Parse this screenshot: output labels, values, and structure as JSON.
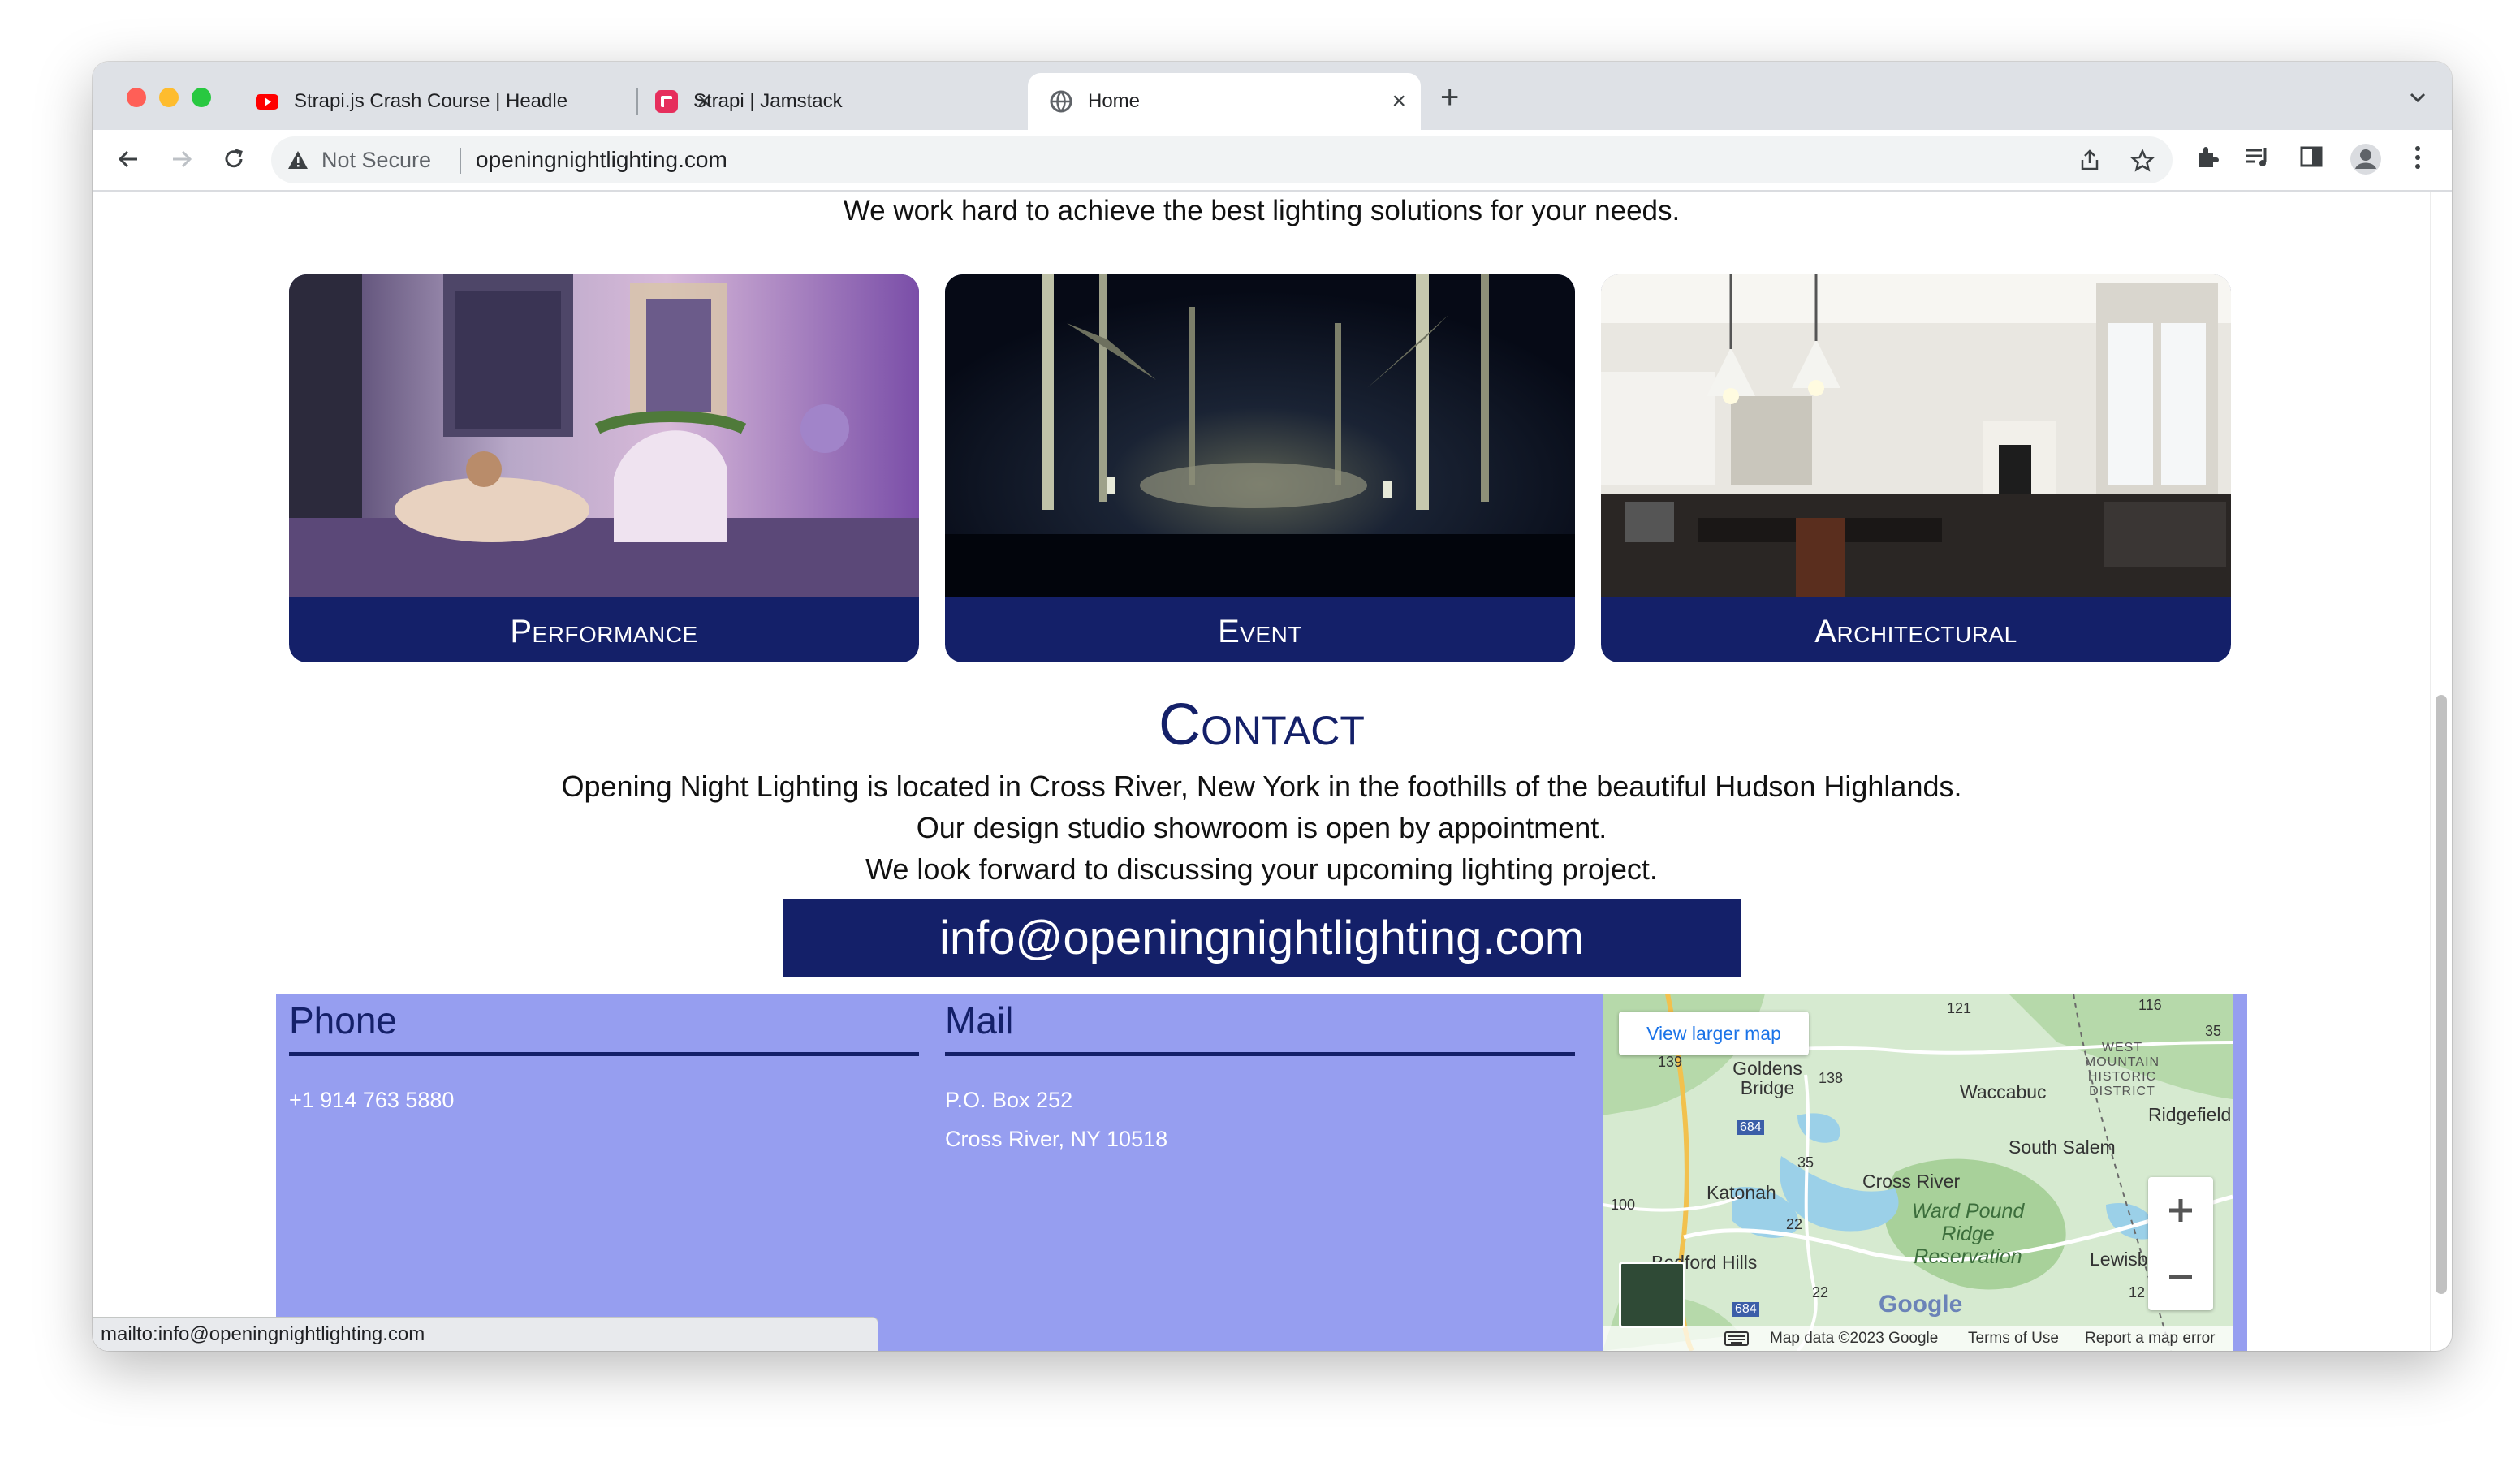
{
  "browser": {
    "tabs": [
      {
        "title": "Strapi.js Crash Course | Headle",
        "icon": "youtube-icon"
      },
      {
        "title": "Strapi | Jamstack",
        "icon": "strapi-icon"
      },
      {
        "title": "Home",
        "icon": "globe-icon"
      }
    ],
    "active_tab_index": 2,
    "security_label": "Not Secure",
    "url": "openingnightlighting.com",
    "status_url": "mailto:info@openingnightlighting.com"
  },
  "page": {
    "intro_line": "We work hard to achieve the best lighting solutions for your needs.",
    "services": [
      {
        "label": "Performance"
      },
      {
        "label": "Event"
      },
      {
        "label": "Architectural"
      }
    ],
    "contact": {
      "heading": "Contact",
      "lines": [
        "Opening Night Lighting is located in Cross River, New York in the foothills of the beautiful Hudson Highlands.",
        "Our design studio showroom is open by appointment.",
        "We look forward to discussing your upcoming lighting project."
      ],
      "email": "info@openingnightlighting.com"
    },
    "footer": {
      "phone_heading": "Phone",
      "phone": "+1 914 763 5880",
      "mail_heading": "Mail",
      "mail_line1": "P.O. Box 252",
      "mail_line2": "Cross River, NY  10518"
    },
    "map": {
      "view_larger": "View larger map",
      "places": [
        "Goldens Bridge",
        "Waccabuc",
        "Cross River",
        "Katonah",
        "South Salem",
        "Ridgefield",
        "Lewisb",
        "Bedford Hills",
        "Ward Pound Ridge Reservation",
        "WEST MOUNTAIN HISTORIC DISTRICT"
      ],
      "routes": [
        "121",
        "116",
        "35",
        "139",
        "138",
        "684",
        "35",
        "100",
        "22",
        "22",
        "684",
        "12"
      ],
      "attribution": "Map data ©2023 Google",
      "terms": "Terms of Use",
      "report": "Report a map error",
      "logo": "Google"
    }
  },
  "colors": {
    "brand_navy": "#142069",
    "footer_bg": "#969ef0"
  }
}
